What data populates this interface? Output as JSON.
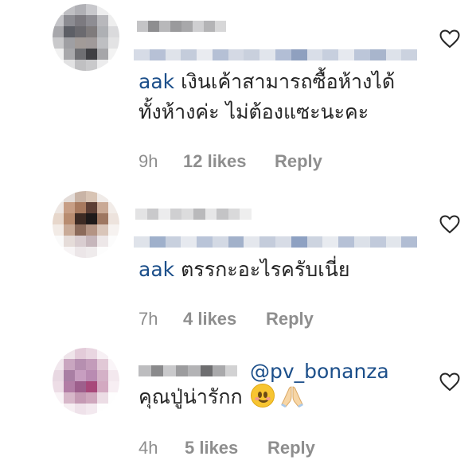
{
  "comments": [
    {
      "reply_mention": "",
      "mention": "aak",
      "line1": " เงินเค้าสามารถซื้อห้างได้",
      "line2": "ทั้งห้างค่ะ ไม่ต้องแซะนะคะ",
      "time": "9h",
      "likes": "12 likes",
      "reply": "Reply",
      "heart_icon": "heart-outline-icon"
    },
    {
      "reply_mention": "",
      "mention": "aak",
      "line1": " ตรรกะอะไรครับเนี่ย",
      "line2": "",
      "time": "7h",
      "likes": "4 likes",
      "reply": "Reply",
      "heart_icon": "heart-outline-icon"
    },
    {
      "reply_mention": "@pv_bonanza",
      "mention": "",
      "line1": "คุณปู่น่ารักก",
      "line2": "",
      "time": "4h",
      "likes": "5 likes",
      "reply": "Reply",
      "heart_icon": "heart-outline-icon",
      "emojis": [
        "smiling-face-emoji",
        "folded-hands-emoji"
      ]
    }
  ],
  "colors": {
    "text": "#262626",
    "muted": "#8e8e8e",
    "mention": "#1c4f8a"
  }
}
